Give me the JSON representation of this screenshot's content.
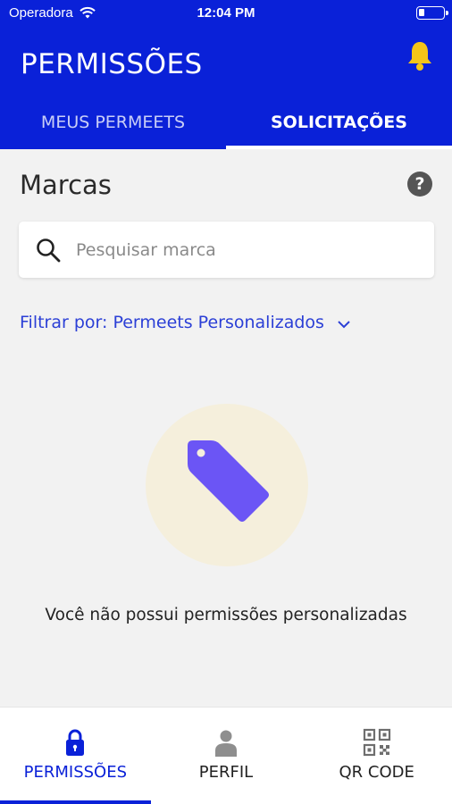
{
  "status_bar": {
    "carrier": "Operadora",
    "time": "12:04 PM"
  },
  "header": {
    "title": "PERMISSÕES",
    "notification_icon": "bell-icon",
    "accent_color": "#0a21d8",
    "bell_color": "#f5c518"
  },
  "tabs": [
    {
      "label": "MEUS PERMEETS",
      "active": false
    },
    {
      "label": "SOLICITAÇÕES",
      "active": true
    }
  ],
  "section": {
    "title": "Marcas",
    "help_icon": "help-icon",
    "help_glyph": "?"
  },
  "search": {
    "placeholder": "Pesquisar marca",
    "value": ""
  },
  "filter": {
    "label": "Filtrar por: Permeets Personalizados"
  },
  "empty_state": {
    "icon": "tag-icon",
    "message": "Você não possui permissões personalizadas",
    "circle_color": "#f5efdc",
    "tag_color": "#6b55f5"
  },
  "bottom_nav": [
    {
      "label": "PERMISSÕES",
      "icon": "lock-icon",
      "active": true
    },
    {
      "label": "PERFIL",
      "icon": "person-icon",
      "active": false
    },
    {
      "label": "QR CODE",
      "icon": "qr-code-icon",
      "active": false
    }
  ]
}
